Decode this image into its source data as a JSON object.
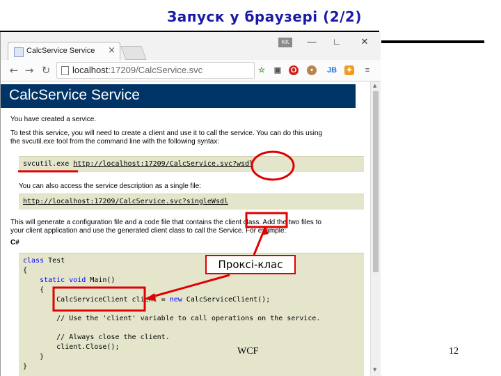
{
  "slide": {
    "title": "Запуск у браузері  (2/2)",
    "footer_center": "WCF",
    "page_number": "12",
    "callout_label": "Проксі-клас"
  },
  "browser": {
    "tab_title": "CalcService Service",
    "tab_close": "×",
    "badge": "KK",
    "url_host": "localhost",
    "url_rest": ":17209/CalcService.svc",
    "back_icon": "arrow-left-icon",
    "forward_icon": "arrow-right-icon",
    "reload_icon": "reload-icon",
    "menu_icon": "menu-icon",
    "extensions": [
      "bookmark-star-icon",
      "opera-icon",
      "cookie-icon",
      "jb-icon",
      "ext-orange-icon"
    ]
  },
  "page": {
    "header": "CalcService Service",
    "p1": "You have created a service.",
    "p2_line1": "To test this service, you will need to create a client and use it to call the service. You can do this using",
    "p2_line2": "the svcutil.exe tool from the command line with the following syntax:",
    "cmd_tool": "svcutil.exe ",
    "cmd_url": "http://localhost:17209/CalcService.svc?wsdl",
    "p3": "You can also access the service description as a single file:",
    "single_url": "http://localhost:17209/CalcService.svc?singleWsdl",
    "p4_line1": "This will generate a configuration file and a code file that contains the client class. Add the two files to",
    "p4_line2": "your client application and use the generated client class to call the Service. For example:",
    "lang_label": "C#",
    "code": {
      "l1_kw": "class",
      "l1_name": " Test",
      "l2": "{",
      "l3_kw": "    static void",
      "l3_rest": " Main()",
      "l4": "    {",
      "l5_a": "        CalcServiceClient client = ",
      "l5_kw": "new",
      "l5_b": " CalcServiceClient();",
      "l6": "        // Use the 'client' variable to call operations on the service.",
      "l7": "        // Always close the client.",
      "l8": "        client.Close();",
      "l9": "    }",
      "l10": "}"
    }
  },
  "colors": {
    "title_blue": "#1a1aa6",
    "header_navy": "#003366",
    "highlight_red": "#e00000",
    "code_bg": "#e5e5cc"
  }
}
